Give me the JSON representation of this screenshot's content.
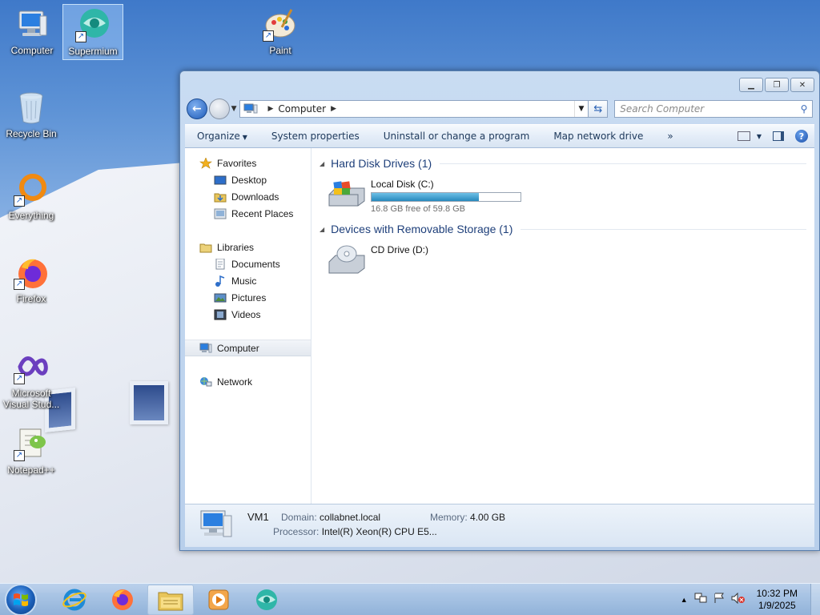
{
  "desktop": {
    "icons": [
      {
        "label": "Computer"
      },
      {
        "label": "Supermium"
      },
      {
        "label": "Paint"
      },
      {
        "label": "Recycle Bin"
      },
      {
        "label": "Everything"
      },
      {
        "label": "Firefox"
      },
      {
        "label": "Microsoft Visual Stud..."
      },
      {
        "label": "Notepad++"
      }
    ]
  },
  "window": {
    "address": {
      "location": "Computer"
    },
    "search": {
      "placeholder": "Search Computer"
    },
    "toolbar": {
      "organize": "Organize",
      "system_properties": "System properties",
      "uninstall": "Uninstall or change a program",
      "map_drive": "Map network drive",
      "more": "»"
    },
    "nav": {
      "favorites": "Favorites",
      "desktop": "Desktop",
      "downloads": "Downloads",
      "recent": "Recent Places",
      "libraries": "Libraries",
      "documents": "Documents",
      "music": "Music",
      "pictures": "Pictures",
      "videos": "Videos",
      "computer": "Computer",
      "network": "Network"
    },
    "content": {
      "hdd_group": "Hard Disk Drives (1)",
      "local_disk": {
        "name": "Local Disk (C:)",
        "free_text": "16.8 GB free of 59.8 GB",
        "used_fraction": 0.72
      },
      "removable_group": "Devices with Removable Storage (1)",
      "cd_drive": {
        "name": "CD Drive (D:)"
      }
    },
    "details": {
      "name": "VM1",
      "domain_label": "Domain:",
      "domain_value": "collabnet.local",
      "memory_label": "Memory:",
      "memory_value": "4.00 GB",
      "processor_label": "Processor:",
      "processor_value": "Intel(R) Xeon(R) CPU E5..."
    }
  },
  "taskbar": {
    "time": "10:32 PM",
    "date": "1/9/2025"
  }
}
